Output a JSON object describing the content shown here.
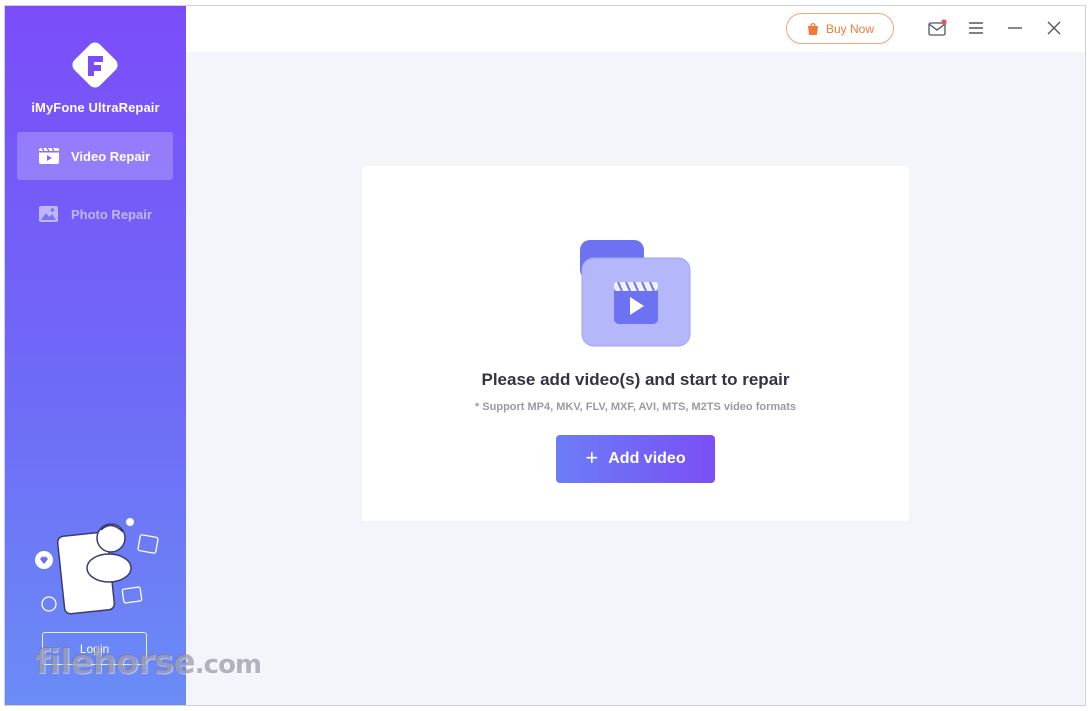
{
  "app": {
    "name": "iMyFone UltraRepair"
  },
  "sidebar": {
    "items": [
      {
        "label": "Video Repair",
        "icon": "video-clapper-icon",
        "active": true
      },
      {
        "label": "Photo Repair",
        "icon": "photo-icon",
        "active": false
      }
    ],
    "login_label": "Login"
  },
  "topbar": {
    "buy_label": "Buy Now",
    "icons": [
      "bag-icon",
      "mail-icon",
      "menu-icon",
      "minimize-icon",
      "close-icon"
    ]
  },
  "main": {
    "title": "Please add video(s) and start to repair",
    "subtitle": "* Support MP4, MKV, FLV, MXF, AVI, MTS, M2TS video formats",
    "add_button_label": "Add video"
  },
  "watermark": {
    "text": "filehorse",
    "suffix": ".com"
  },
  "colors": {
    "sidebar_top": "#7b4dfa",
    "sidebar_bottom": "#6a8cf6",
    "accent_orange": "#f07a3c",
    "button_start": "#6c7df7",
    "button_end": "#7a4ff6",
    "background": "#f4f4fb"
  }
}
